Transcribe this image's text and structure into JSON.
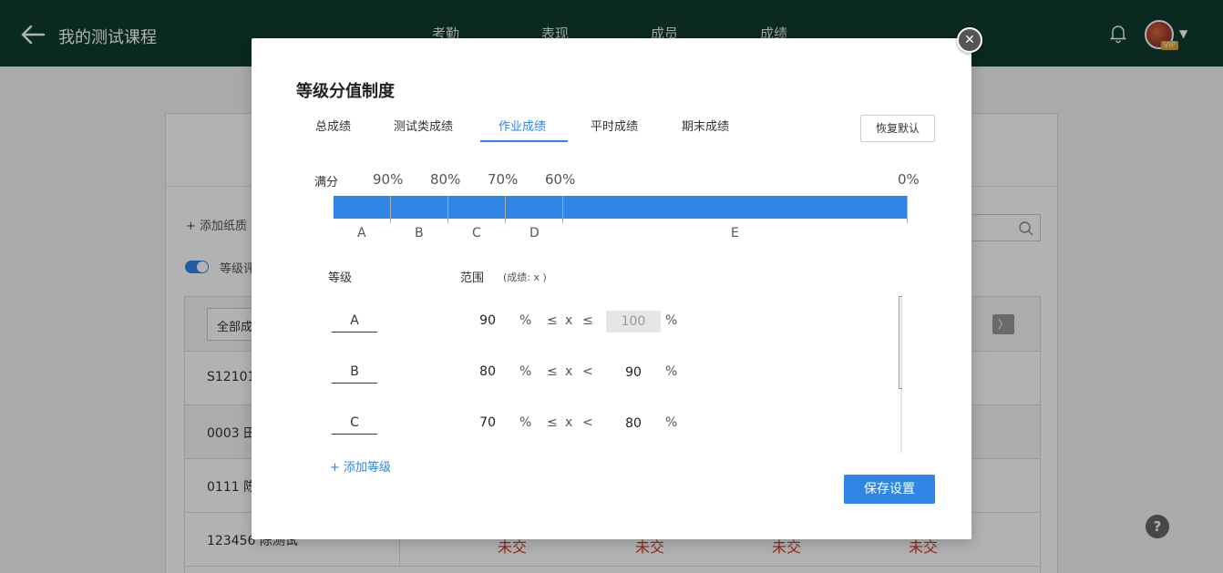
{
  "header": {
    "course_title": "我的测试课程",
    "nav": [
      "考勤",
      "表现",
      "成员",
      "成绩"
    ],
    "vip_badge": "VIP"
  },
  "background": {
    "add_link": "添加纸质",
    "toggle_label": "等级评",
    "filter_label": "全部成",
    "rows": [
      {
        "id": "S12101",
        "status": [
          "",
          "",
          "",
          ""
        ]
      },
      {
        "id": "0003 田",
        "status": [
          "",
          "",
          "",
          ""
        ]
      },
      {
        "id": "0111 陈",
        "status": [
          "",
          "",
          "",
          ""
        ]
      },
      {
        "id": "123456 陈测试",
        "status": [
          "未交",
          "未交",
          "未交",
          "未交"
        ]
      }
    ]
  },
  "modal": {
    "title": "等级分值制度",
    "tabs": [
      "总成绩",
      "测试类成绩",
      "作业成绩",
      "平时成绩",
      "期末成绩"
    ],
    "active_tab": 2,
    "reset_label": "恢复默认",
    "scale": {
      "full_label": "满分",
      "percent_labels": [
        "90%",
        "80%",
        "70%",
        "60%",
        "0%"
      ],
      "grade_letters": [
        "A",
        "B",
        "C",
        "D",
        "E"
      ]
    },
    "columns": {
      "grade": "等级",
      "range": "范围",
      "range_hint": "(成绩: x )"
    },
    "grades": [
      {
        "name": "A",
        "min": "90",
        "op1": "≤",
        "op2": "≤",
        "max": "100",
        "max_disabled": true
      },
      {
        "name": "B",
        "min": "80",
        "op1": "≤",
        "op2": "<",
        "max": "90",
        "max_disabled": false
      },
      {
        "name": "C",
        "min": "70",
        "op1": "≤",
        "op2": "<",
        "max": "80",
        "max_disabled": false
      }
    ],
    "percent_sign": "%",
    "var_x": "x",
    "add_grade": "+ 添加等级",
    "save_label": "保存设置"
  },
  "colors": {
    "header_bg": "#0f3b2e",
    "accent": "#2f86e5",
    "overdue": "#d43a2a"
  }
}
